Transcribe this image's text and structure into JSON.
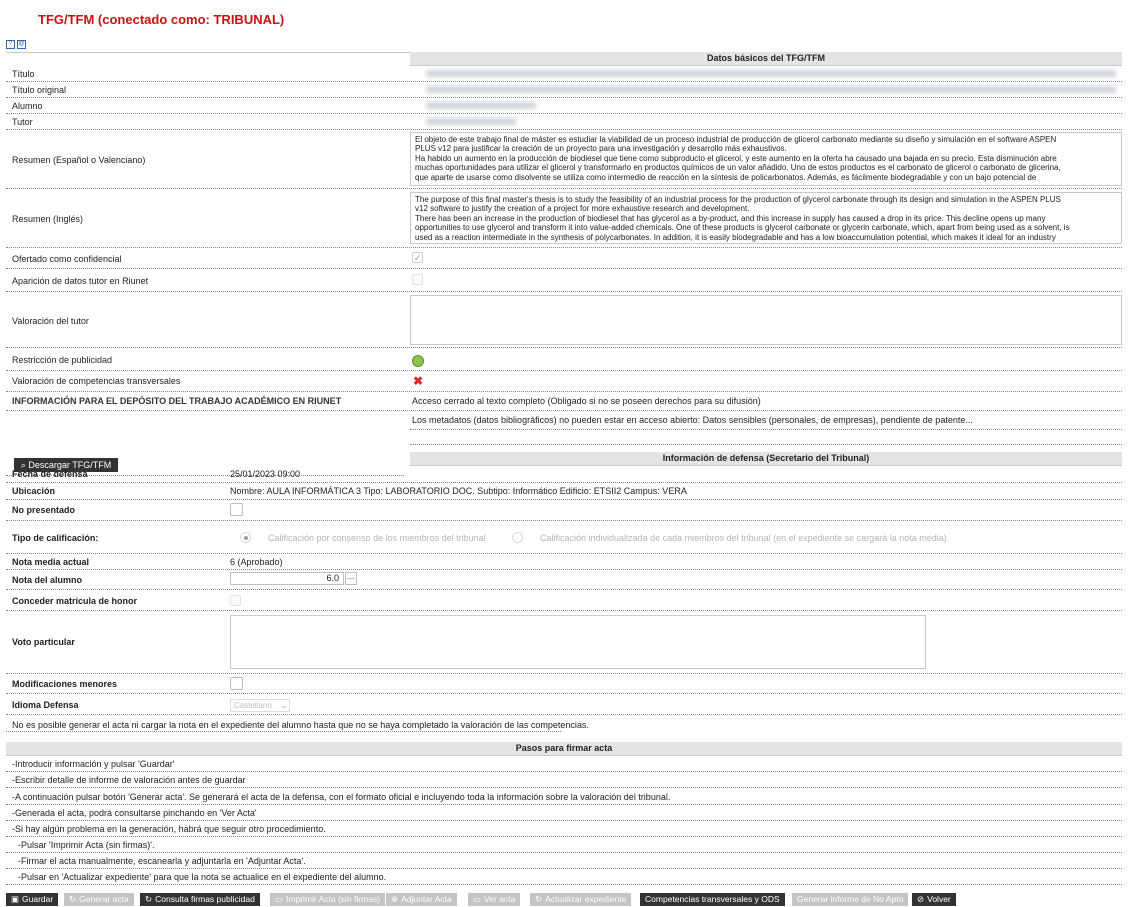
{
  "page": {
    "title": "TFG/TFM (conectado como: TRIBUNAL)"
  },
  "sections": {
    "basic": "Datos básicos del TFG/TFM",
    "defense": "Información de defensa (Secretario del Tribunal)",
    "steps": "Pasos para firmar acta"
  },
  "basic": {
    "titulo": "Título",
    "titulo_original": "Título original",
    "alumno": "Alumno",
    "tutor": "Tutor",
    "resumen_es_label": "Resumen (Español o Valenciano)",
    "resumen_es_lines": [
      "El objeto de este trabajo final de máster es estudiar la viabilidad de un proceso industrial de producción de glicerol carbonato mediante su diseño y simulación en el software ASPEN",
      "PLUS v12 para justificar la creación de un proyecto para una investigación y desarrollo más exhaustivos.",
      "Ha habido un aumento en la producción de biodiesel que tiene como subproducto el glicerol, y este aumento en la oferta ha causado una bajada en su precio. Esta disminución abre",
      "muchas oportunidades para utilizar el glicerol y transformarlo en productos químicos de un valor añadido. Uno de estos productos es el carbonato de glicerol o carbonato de glicerina,",
      "que aparte de usarse como disolvente se utiliza como intermedio de reacción en la síntesis de policarbonatos. Además, es fácilmente biodegradable y con un bajo potencial de"
    ],
    "resumen_en_label": "Resumen (Inglés)",
    "resumen_en_lines": [
      "The purpose of this final master's thesis is to study the feasibility of an industrial process for the production of glycerol carbonate through its design and simulation in the ASPEN PLUS",
      "v12 software to justify the creation of a project for more exhaustive research and development.",
      "There has been an increase in the production of biodiesel that has glycerol as a by-product, and this increase in supply has caused a drop in its price. This decline opens up many",
      "opportunities to use glycerol and transform it into value-added chemicals. One of these products is glycerol carbonate or glycerin carbonate, which, apart from being used as a solvent, is",
      "used as a reaction intermediate in the synthesis of polycarbonates. In addition, it is easily biodegradable and has a low bioaccumulation potential, which makes it ideal for an industry"
    ],
    "confidencial": "Ofertado como confidencial",
    "riunet_tutor": "Aparición de datos tutor en Riunet",
    "valoracion_tutor": "Valoración del tutor",
    "restriccion": "Restricción de publicidad",
    "competencias": "Valoración de competencias transversales",
    "info_deposito": "INFORMACIÓN PARA EL DEPÓSITO DEL TRABAJO ACADÉMICO EN RIUNET",
    "acceso": "Acceso cerrado al texto completo (Obligado si no se poseen derechos para su difusión)",
    "metadatos": "Los metadatos (datos bibliográficos) no pueden estar en acceso abierto: Datos sensibles (personales, de empresas), pendiente de patente...",
    "download_btn": "Descargar TFG/TFM"
  },
  "defense": {
    "fecha_label": "Fecha de defensa",
    "fecha_value": "25/01/2023 09:00",
    "ubicacion_label": "Ubicación",
    "ubicacion_value": "Nombre: AULA INFORMÁTICA 3 Tipo: LABORATORIO DOC. Subtipo: Informático Edificio: ETSII2 Campus: VERA",
    "no_presentado": "No presentado",
    "tipo_label": "Tipo de calificación:",
    "tipo_opt1": "Calificación por consenso de los miembros del tribunal",
    "tipo_opt2": "Calificación individualizada de cada miembros del tribunal (en el expediente se cargará la nota media)",
    "nota_media_label": "Nota media actual",
    "nota_media_value": "6 (Aprobado)",
    "nota_alumno_label": "Nota del alumno",
    "nota_alumno_value": "6.0",
    "matricula": "Conceder matrícula de honor",
    "voto": "Voto particular",
    "modificaciones": "Modificaciones menores",
    "idioma_label": "Idioma Defensa",
    "idioma_value": "Castellano",
    "aviso": "No es posible generar el acta ni cargar la nota en el expediente del alumno hasta que no se haya completado la valoración de las competencias."
  },
  "steps": [
    "-Introducir información y pulsar 'Guardar'",
    "-Escribir detalle de informe de valoración antes de guardar",
    "-A continuación pulsar botón 'Generar acta'. Se generará el acta de la defensa, con el formato oficial e incluyendo toda la información sobre la valoración del tribunal.",
    "-Generada el acta, podrá consultarse pinchando en 'Ver Acta'",
    "-Si hay algún problema en la generación, habrá que seguir otro procedimiento.",
    "   -Pulsar 'Imprimir Acta (sin firmas)'.",
    "   -Firmar el acta manualmente, escanearla y adjuntarla en 'Adjuntar Acta'.",
    "   -Pulsar en 'Actualizar expediente' para que la nota se actualice en el expediente del alumno."
  ],
  "buttons": {
    "guardar": "Guardar",
    "generar": "Generar acta",
    "consulta": "Consulta firmas publicidad",
    "imprimir": "Imprimir Acta (sin firmas)",
    "adjuntar": "Adjuntar Acta",
    "ver": "Ver acta",
    "actualizar": "Actualizar expediente",
    "competencias": "Competencias transversales y ODS",
    "noapto": "Generar informe de No Apto",
    "volver": "Volver"
  },
  "colors": {
    "title": "#cc1111",
    "header_bg": "#e4e4e4",
    "button_dark": "#333333",
    "button_disabled": "#c4c4c4"
  }
}
